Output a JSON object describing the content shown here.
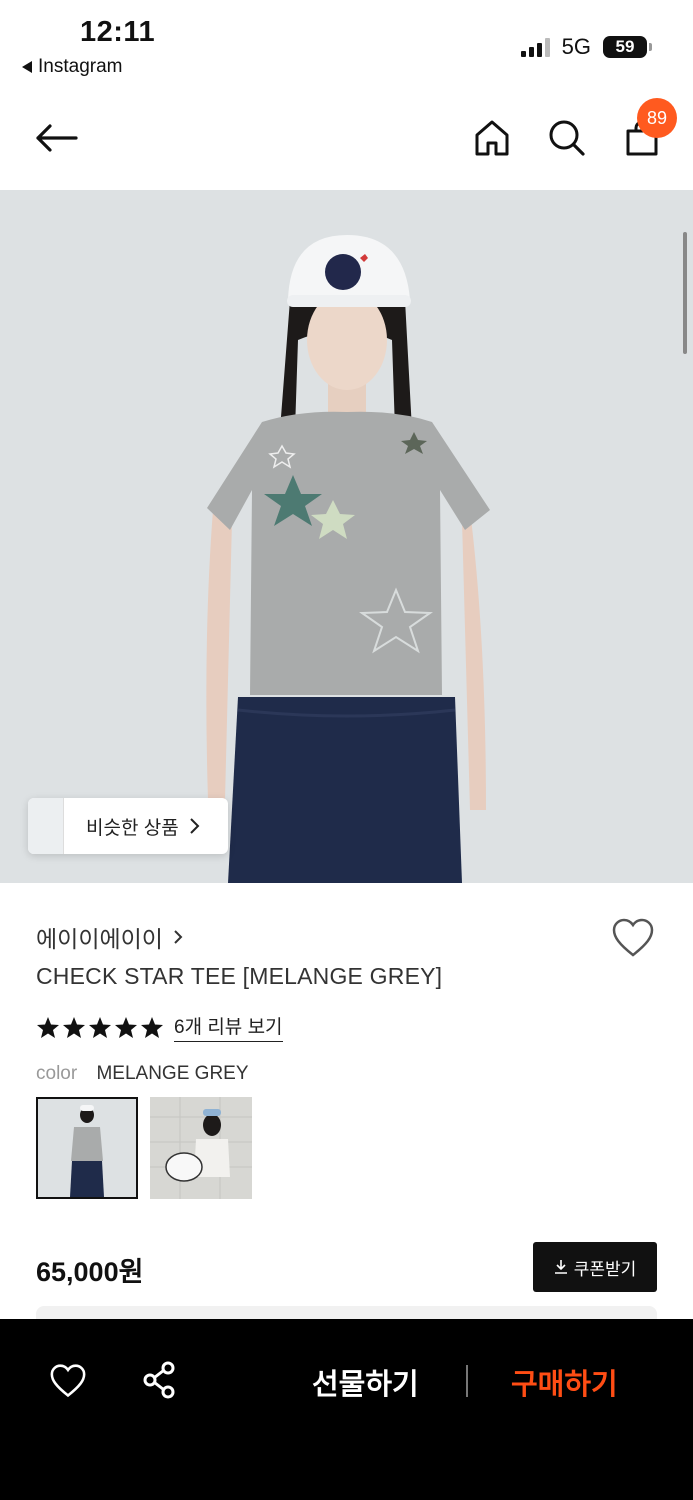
{
  "status_bar": {
    "time": "12:11",
    "back_app": "Instagram",
    "network": "5G",
    "battery": "59"
  },
  "header": {
    "cart_count": "89",
    "icons": [
      "back-arrow-icon",
      "home-icon",
      "search-icon",
      "shopping-bag-icon"
    ]
  },
  "hero": {
    "similar_label": "비슷한 상품"
  },
  "product": {
    "brand": "에이이에이이",
    "title": "CHECK STAR TEE [MELANGE GREY]",
    "rating_stars": 5,
    "review_link": "6개 리뷰 보기",
    "color_label": "color",
    "color_value": "MELANGE GREY",
    "price": "65,000원",
    "coupon_label": "쿠폰받기"
  },
  "bottom_bar": {
    "gift_label": "선물하기",
    "buy_label": "구매하기"
  },
  "colors": {
    "accent": "#ff5a1f",
    "buy": "#ff4d14",
    "bar_bg": "#000000"
  }
}
